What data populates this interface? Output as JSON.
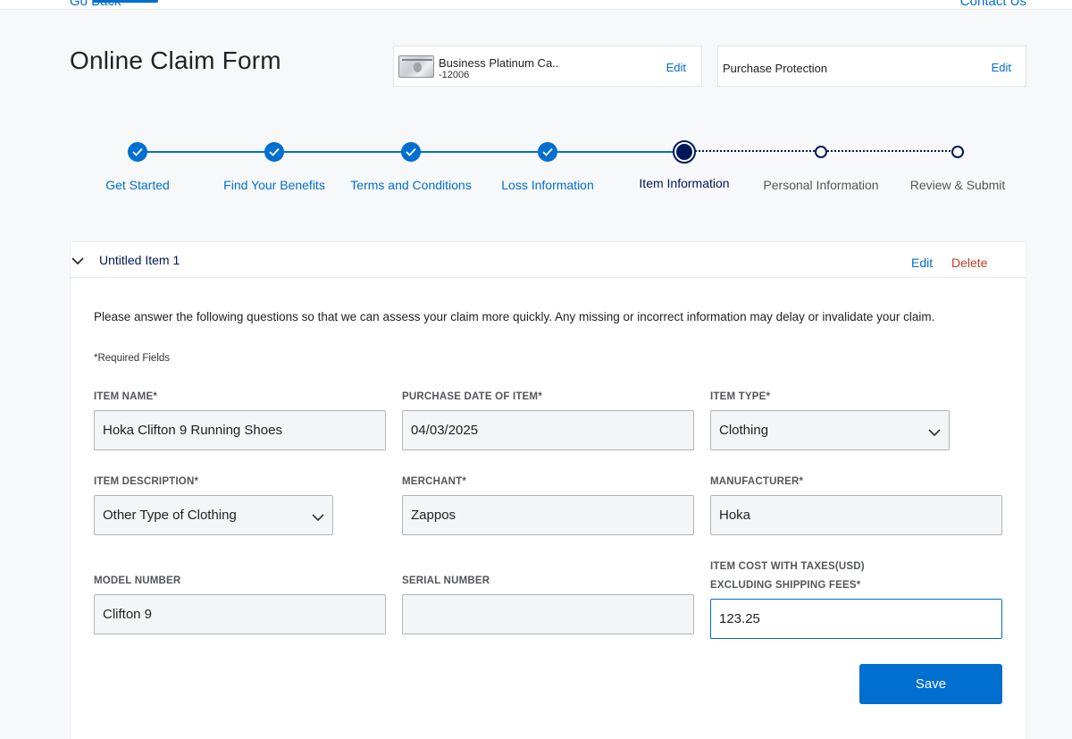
{
  "nav": {
    "go_back": "Go Back",
    "contact_us": "Contact Us"
  },
  "page_title": "Online Claim Form",
  "summary": {
    "card": {
      "name": "Business Platinum Ca..",
      "number": "-12006",
      "edit_label": "Edit"
    },
    "benefit": {
      "label": "Purchase Protection",
      "edit_label": "Edit"
    }
  },
  "stepper": {
    "steps": [
      {
        "label": "Get Started",
        "status": "complete"
      },
      {
        "label": "Find Your Benefits",
        "status": "complete"
      },
      {
        "label": "Terms and Conditions",
        "status": "complete"
      },
      {
        "label": "Loss Information",
        "status": "complete"
      },
      {
        "label": "Item Information",
        "status": "current"
      },
      {
        "label": "Personal Information",
        "status": "upcoming"
      },
      {
        "label": "Review & Submit",
        "status": "upcoming"
      }
    ]
  },
  "item": {
    "title": "Untitled Item 1",
    "edit_label": "Edit",
    "delete_label": "Delete",
    "intro": "Please answer the following questions so that we can assess your claim more quickly. Any missing or incorrect information may delay or invalidate your claim.",
    "required_note": "*Required Fields",
    "fields": {
      "item_name": {
        "label": "ITEM NAME*",
        "value": "Hoka Clifton 9 Running Shoes"
      },
      "purchase_date": {
        "label": "PURCHASE DATE OF ITEM*",
        "value": "04/03/2025"
      },
      "item_type": {
        "label": "ITEM TYPE*",
        "value": "Clothing"
      },
      "item_description": {
        "label": "ITEM DESCRIPTION*",
        "value": "Other Type of Clothing"
      },
      "merchant": {
        "label": "MERCHANT*",
        "value": "Zappos"
      },
      "manufacturer": {
        "label": "MANUFACTURER*",
        "value": "Hoka"
      },
      "model_number": {
        "label": "MODEL NUMBER",
        "value": "Clifton 9"
      },
      "serial_number": {
        "label": "SERIAL NUMBER",
        "value": ""
      },
      "item_cost": {
        "label_line1": "ITEM COST WITH TAXES(USD)",
        "label_line2": "EXCLUDING SHIPPING FEES*",
        "value": "123.25"
      }
    },
    "save_label": "Save"
  },
  "colors": {
    "accent": "#006fcf",
    "navy": "#00175a",
    "delete": "#c23b22"
  }
}
